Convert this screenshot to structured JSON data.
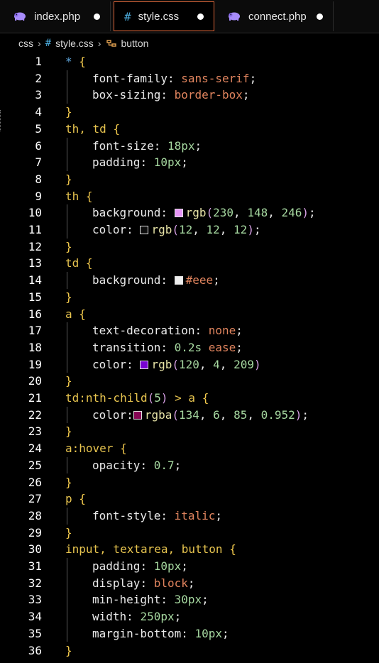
{
  "tabs": [
    {
      "label": "index.php",
      "icon": "php-elephant-icon",
      "active": false,
      "modified": true
    },
    {
      "label": "style.css",
      "icon": "css-hash-icon",
      "active": true,
      "modified": true
    },
    {
      "label": "connect.php",
      "icon": "php-elephant-icon",
      "active": false,
      "modified": true
    }
  ],
  "breadcrumb": {
    "folder": "css",
    "file": "style.css",
    "symbol": "button"
  },
  "colors": {
    "active_tab_border": "#e0683a",
    "php_icon": "#a78bfa",
    "css_icon": "#4aa8d8"
  },
  "lines": [
    {
      "n": "1",
      "t": [
        [
          "star",
          "*"
        ],
        [
          "punc",
          " "
        ],
        [
          "brace",
          "{"
        ]
      ]
    },
    {
      "n": "2",
      "t": [
        [
          "prop",
          "font-family"
        ],
        [
          "punc",
          ": "
        ],
        [
          "val",
          "sans-serif"
        ],
        [
          "punc",
          ";"
        ]
      ]
    },
    {
      "n": "3",
      "t": [
        [
          "prop",
          "box-sizing"
        ],
        [
          "punc",
          ": "
        ],
        [
          "val",
          "border-box"
        ],
        [
          "punc",
          ";"
        ]
      ]
    },
    {
      "n": "4",
      "t": [
        [
          "brace",
          "}"
        ]
      ]
    },
    {
      "n": "5",
      "t": [
        [
          "sel",
          "th, td "
        ],
        [
          "brace",
          "{"
        ]
      ]
    },
    {
      "n": "6",
      "t": [
        [
          "prop",
          "font-size"
        ],
        [
          "punc",
          ": "
        ],
        [
          "num",
          "18px"
        ],
        [
          "punc",
          ";"
        ]
      ]
    },
    {
      "n": "7",
      "t": [
        [
          "prop",
          "padding"
        ],
        [
          "punc",
          ": "
        ],
        [
          "num",
          "10px"
        ],
        [
          "punc",
          ";"
        ]
      ]
    },
    {
      "n": "8",
      "t": [
        [
          "brace",
          "}"
        ]
      ]
    },
    {
      "n": "9",
      "t": [
        [
          "sel",
          "th "
        ],
        [
          "brace",
          "{"
        ]
      ]
    },
    {
      "n": "10",
      "t": [
        [
          "prop",
          "background"
        ],
        [
          "punc",
          ": "
        ],
        [
          "swatch",
          "#e694f6"
        ],
        [
          "fn",
          "rgb"
        ],
        [
          "paren",
          "("
        ],
        [
          "num",
          "230"
        ],
        [
          "punc",
          ", "
        ],
        [
          "num",
          "148"
        ],
        [
          "punc",
          ", "
        ],
        [
          "num",
          "246"
        ],
        [
          "paren",
          ")"
        ],
        [
          "punc",
          ";"
        ]
      ]
    },
    {
      "n": "11",
      "t": [
        [
          "prop",
          "color"
        ],
        [
          "punc",
          ": "
        ],
        [
          "swatch",
          "#0c0c0c"
        ],
        [
          "fn",
          "rgb"
        ],
        [
          "paren",
          "("
        ],
        [
          "num",
          "12"
        ],
        [
          "punc",
          ", "
        ],
        [
          "num",
          "12"
        ],
        [
          "punc",
          ", "
        ],
        [
          "num",
          "12"
        ],
        [
          "paren",
          ")"
        ],
        [
          "punc",
          ";"
        ]
      ]
    },
    {
      "n": "12",
      "t": [
        [
          "brace",
          "}"
        ]
      ]
    },
    {
      "n": "13",
      "t": [
        [
          "sel",
          "td "
        ],
        [
          "brace",
          "{"
        ]
      ]
    },
    {
      "n": "14",
      "t": [
        [
          "prop",
          "background"
        ],
        [
          "punc",
          ": "
        ],
        [
          "swatch",
          "#eeeeee"
        ],
        [
          "hex",
          "#eee"
        ],
        [
          "punc",
          ";"
        ]
      ]
    },
    {
      "n": "15",
      "t": [
        [
          "brace",
          "}"
        ]
      ]
    },
    {
      "n": "16",
      "t": [
        [
          "sel",
          "a "
        ],
        [
          "brace",
          "{"
        ]
      ]
    },
    {
      "n": "17",
      "t": [
        [
          "prop",
          "text-decoration"
        ],
        [
          "punc",
          ": "
        ],
        [
          "val",
          "none"
        ],
        [
          "punc",
          ";"
        ]
      ]
    },
    {
      "n": "18",
      "t": [
        [
          "prop",
          "transition"
        ],
        [
          "punc",
          ": "
        ],
        [
          "num",
          "0.2s"
        ],
        [
          "punc",
          " "
        ],
        [
          "val",
          "ease"
        ],
        [
          "punc",
          ";"
        ]
      ]
    },
    {
      "n": "19",
      "t": [
        [
          "prop",
          "color"
        ],
        [
          "punc",
          ": "
        ],
        [
          "swatch",
          "#7804d1"
        ],
        [
          "fn",
          "rgb"
        ],
        [
          "paren",
          "("
        ],
        [
          "num",
          "120"
        ],
        [
          "punc",
          ", "
        ],
        [
          "num",
          "4"
        ],
        [
          "punc",
          ", "
        ],
        [
          "num",
          "209"
        ],
        [
          "paren",
          ")"
        ]
      ]
    },
    {
      "n": "20",
      "t": [
        [
          "brace",
          "}"
        ]
      ]
    },
    {
      "n": "21",
      "t": [
        [
          "sel",
          "td:nth-child"
        ],
        [
          "paren",
          "("
        ],
        [
          "num",
          "5"
        ],
        [
          "paren",
          ")"
        ],
        [
          "sel",
          " > a "
        ],
        [
          "brace",
          "{"
        ]
      ]
    },
    {
      "n": "22",
      "t": [
        [
          "prop",
          "color"
        ],
        [
          "punc",
          ":"
        ],
        [
          "swatch",
          "#860655"
        ],
        [
          "fn",
          "rgba"
        ],
        [
          "paren",
          "("
        ],
        [
          "num",
          "134"
        ],
        [
          "punc",
          ", "
        ],
        [
          "num",
          "6"
        ],
        [
          "punc",
          ", "
        ],
        [
          "num",
          "85"
        ],
        [
          "punc",
          ", "
        ],
        [
          "num",
          "0.952"
        ],
        [
          "paren",
          ")"
        ],
        [
          "punc",
          ";"
        ]
      ]
    },
    {
      "n": "23",
      "t": [
        [
          "brace",
          "}"
        ]
      ]
    },
    {
      "n": "24",
      "t": [
        [
          "sel",
          "a:hover "
        ],
        [
          "brace",
          "{"
        ]
      ]
    },
    {
      "n": "25",
      "t": [
        [
          "prop",
          "opacity"
        ],
        [
          "punc",
          ": "
        ],
        [
          "num",
          "0.7"
        ],
        [
          "punc",
          ";"
        ]
      ]
    },
    {
      "n": "26",
      "t": [
        [
          "brace",
          "}"
        ]
      ]
    },
    {
      "n": "27",
      "t": [
        [
          "sel",
          "p "
        ],
        [
          "brace",
          "{"
        ]
      ]
    },
    {
      "n": "28",
      "t": [
        [
          "prop",
          "font-style"
        ],
        [
          "punc",
          ": "
        ],
        [
          "val",
          "italic"
        ],
        [
          "punc",
          ";"
        ]
      ]
    },
    {
      "n": "29",
      "t": [
        [
          "brace",
          "}"
        ]
      ]
    },
    {
      "n": "30",
      "t": [
        [
          "sel",
          "input, textarea, button "
        ],
        [
          "brace",
          "{"
        ]
      ]
    },
    {
      "n": "31",
      "t": [
        [
          "prop",
          "padding"
        ],
        [
          "punc",
          ": "
        ],
        [
          "num",
          "10px"
        ],
        [
          "punc",
          ";"
        ]
      ]
    },
    {
      "n": "32",
      "t": [
        [
          "prop",
          "display"
        ],
        [
          "punc",
          ": "
        ],
        [
          "val",
          "block"
        ],
        [
          "punc",
          ";"
        ]
      ]
    },
    {
      "n": "33",
      "t": [
        [
          "prop",
          "min-height"
        ],
        [
          "punc",
          ": "
        ],
        [
          "num",
          "30px"
        ],
        [
          "punc",
          ";"
        ]
      ]
    },
    {
      "n": "34",
      "t": [
        [
          "prop",
          "width"
        ],
        [
          "punc",
          ": "
        ],
        [
          "num",
          "250px"
        ],
        [
          "punc",
          ";"
        ]
      ]
    },
    {
      "n": "35",
      "t": [
        [
          "prop",
          "margin-bottom"
        ],
        [
          "punc",
          ": "
        ],
        [
          "num",
          "10px"
        ],
        [
          "punc",
          ";"
        ]
      ]
    },
    {
      "n": "36",
      "t": [
        [
          "brace",
          "}"
        ]
      ]
    }
  ]
}
